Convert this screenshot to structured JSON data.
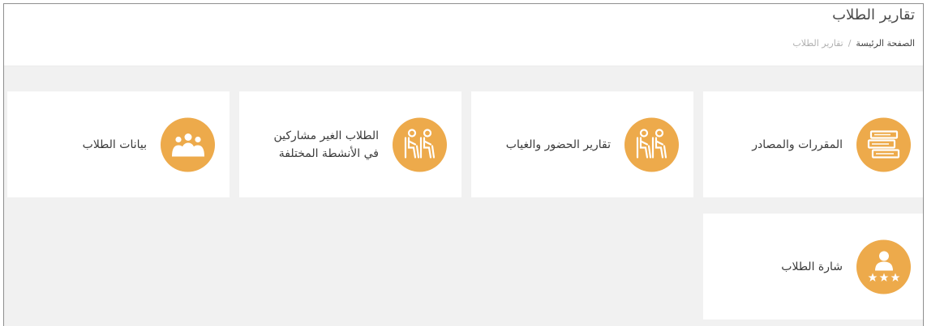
{
  "header": {
    "title": "تقارير الطلاب",
    "breadcrumb": {
      "home": "الصفحة الرئيسة",
      "separator": "/",
      "current": "تقارير الطلاب"
    }
  },
  "cards": [
    {
      "label": "المقررات والمصادر",
      "icon": "books-icon"
    },
    {
      "label": "تقارير الحضور والغياب",
      "icon": "classroom-icon"
    },
    {
      "label_line1": "الطلاب الغير مشاركين",
      "label_line2": "في الأنشطة المختلفة",
      "icon": "classroom-icon"
    },
    {
      "label": "بيانات الطلاب",
      "icon": "group-icon"
    },
    {
      "label": "شارة الطلاب",
      "icon": "student-badge-icon"
    }
  ],
  "colors": {
    "accent": "#edaa4b",
    "background": "#f1f1f1",
    "card": "#ffffff",
    "text": "#3a3a3a"
  }
}
